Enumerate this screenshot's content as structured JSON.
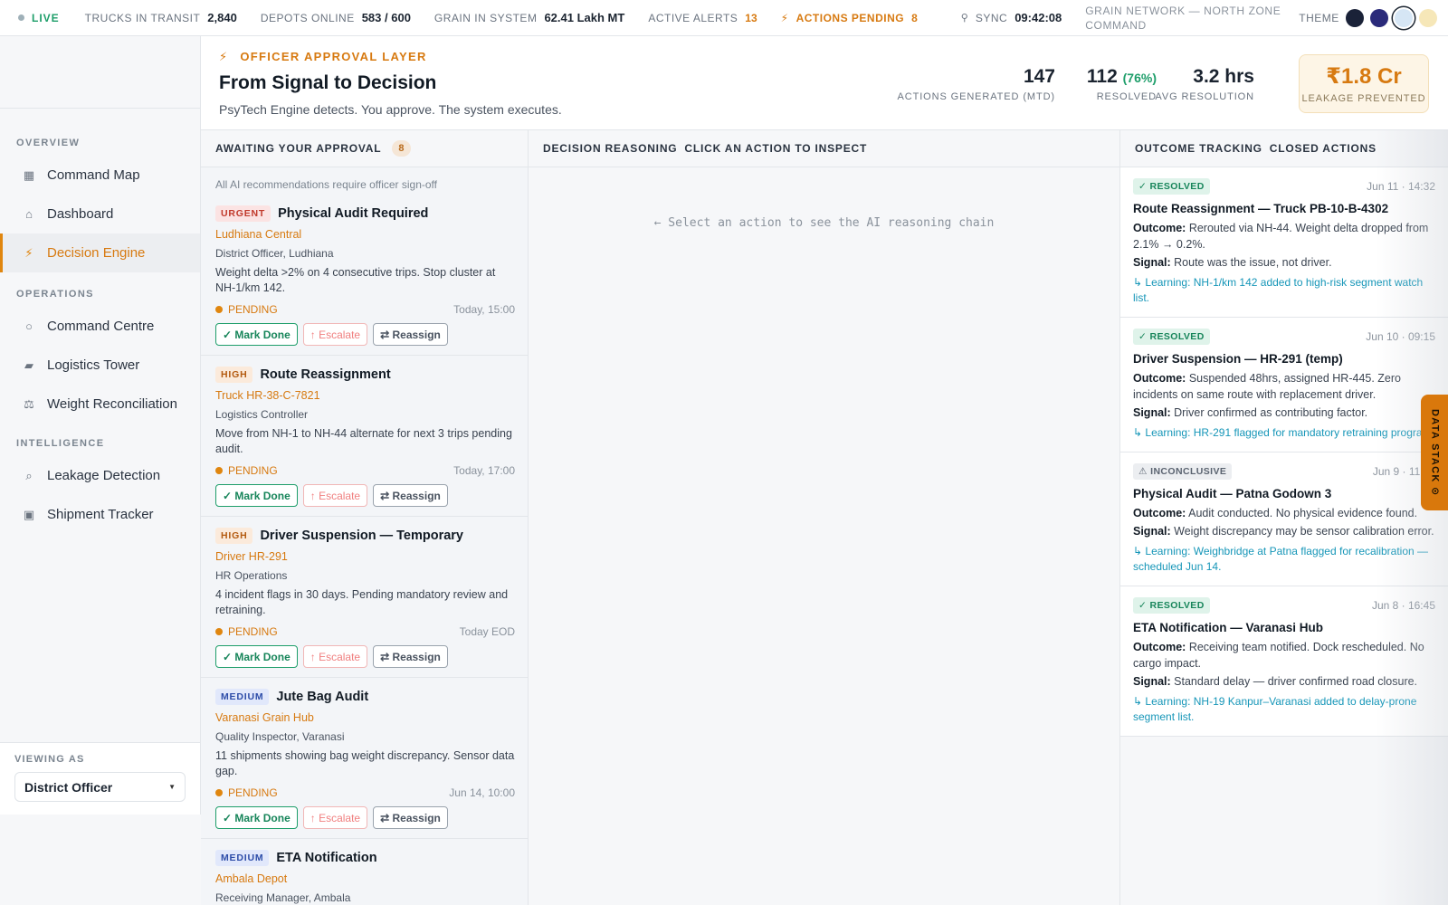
{
  "topbar": {
    "live": "LIVE",
    "trucks_label": "TRUCKS IN TRANSIT",
    "trucks_value": "2,840",
    "depots_label": "DEPOTS ONLINE",
    "depots_value": "583 / 600",
    "grain_label": "GRAIN IN SYSTEM",
    "grain_value": "62.41 Lakh MT",
    "alerts_label": "ACTIVE ALERTS",
    "alerts_value": "13",
    "actions_label": "ACTIONS PENDING",
    "actions_value": "8",
    "sync_label": "SYNC",
    "sync_value": "09:42:08",
    "network": "GRAIN NETWORK — NORTH ZONE COMMAND",
    "theme_label": "THEME",
    "theme_swatches": [
      "#1a2238",
      "#2a2a7a",
      "#d6e6f5",
      "#f6e7b8"
    ]
  },
  "sidebar": {
    "sections": [
      {
        "label": "OVERVIEW",
        "items": [
          {
            "label": "Command Map",
            "icon": "map-icon"
          },
          {
            "label": "Dashboard",
            "icon": "home-icon"
          },
          {
            "label": "Decision Engine",
            "icon": "bolt-icon",
            "active": true
          }
        ]
      },
      {
        "label": "OPERATIONS",
        "items": [
          {
            "label": "Command Centre",
            "icon": "circle-icon"
          },
          {
            "label": "Logistics Tower",
            "icon": "truck-icon"
          },
          {
            "label": "Weight Reconciliation",
            "icon": "scale-icon"
          }
        ]
      },
      {
        "label": "INTELLIGENCE",
        "items": [
          {
            "label": "Leakage Detection",
            "icon": "magnifier-icon"
          },
          {
            "label": "Shipment Tracker",
            "icon": "package-icon"
          }
        ]
      }
    ],
    "viewing_label": "VIEWING AS",
    "viewing_value": "District Officer"
  },
  "header": {
    "eyebrow": "OFFICER APPROVAL LAYER",
    "title": "From Signal to Decision",
    "subtitle": "PsyTech Engine detects. You approve. The system executes.",
    "stats": {
      "generated_value": "147",
      "generated_label": "ACTIONS GENERATED (MTD)",
      "resolved_value": "112",
      "resolved_pct": "(76%)",
      "resolved_label": "RESOLVED",
      "avg_value": "3.2 hrs",
      "avg_label": "AVG RESOLUTION",
      "leak_value": "₹1.8 Cr",
      "leak_label": "LEAKAGE PREVENTED"
    }
  },
  "approvals": {
    "title": "AWAITING YOUR APPROVAL",
    "count": "8",
    "note": "All AI recommendations require officer sign-off",
    "button_done": "✓ Mark Done",
    "button_escalate": "↑ Escalate",
    "button_reassign": "⇄ Reassign",
    "cards": [
      {
        "priority": "URGENT",
        "level": "urgent",
        "title": "Physical Audit Required",
        "target": "Ludhiana Central",
        "role": "District Officer, Ludhiana",
        "desc": "Weight delta >2% on 4 consecutive trips. Stop cluster at NH-1/km 142.",
        "status": "PENDING",
        "due": "Today, 15:00"
      },
      {
        "priority": "HIGH",
        "level": "high",
        "title": "Route Reassignment",
        "target": "Truck HR-38-C-7821",
        "role": "Logistics Controller",
        "desc": "Move from NH-1 to NH-44 alternate for next 3 trips pending audit.",
        "status": "PENDING",
        "due": "Today, 17:00"
      },
      {
        "priority": "HIGH",
        "level": "high",
        "title": "Driver Suspension — Temporary",
        "target": "Driver HR-291",
        "role": "HR Operations",
        "desc": "4 incident flags in 30 days. Pending mandatory review and retraining.",
        "status": "PENDING",
        "due": "Today EOD"
      },
      {
        "priority": "MEDIUM",
        "level": "medium",
        "title": "Jute Bag Audit",
        "target": "Varanasi Grain Hub",
        "role": "Quality Inspector, Varanasi",
        "desc": "11 shipments showing bag weight discrepancy. Sensor data gap.",
        "status": "PENDING",
        "due": "Jun 14, 10:00"
      },
      {
        "priority": "MEDIUM",
        "level": "medium",
        "title": "ETA Notification",
        "target": "Ambala Depot",
        "role": "Receiving Manager, Ambala",
        "desc": "",
        "status": "",
        "due": ""
      }
    ]
  },
  "reasoning": {
    "title": "DECISION REASONING",
    "hint": "CLICK AN ACTION TO INSPECT",
    "empty": "← Select an action to see the AI reasoning chain"
  },
  "outcomes": {
    "title": "OUTCOME TRACKING",
    "hint": "CLOSED ACTIONS",
    "outcome_label": "Outcome:",
    "signal_label": "Signal:",
    "cards": [
      {
        "badge": "✓ RESOLVED",
        "kind": "res",
        "date": "Jun 11 · 14:32",
        "title": "Route Reassignment — Truck PB-10-B-4302",
        "outcome": "Rerouted via NH-44. Weight delta dropped from 2.1% → 0.2%.",
        "signal": "Route was the issue, not driver.",
        "learning": "↳ Learning: NH-1/km 142 added to high-risk segment watch list."
      },
      {
        "badge": "✓ RESOLVED",
        "kind": "res",
        "date": "Jun 10 · 09:15",
        "title": "Driver Suspension — HR-291 (temp)",
        "outcome": "Suspended 48hrs, assigned HR-445. Zero incidents on same route with replacement driver.",
        "signal": "Driver confirmed as contributing factor.",
        "learning": "↳ Learning: HR-291 flagged for mandatory retraining program."
      },
      {
        "badge": "⚠ INCONCLUSIVE",
        "kind": "inc",
        "date": "Jun 9 · 11:20",
        "title": "Physical Audit — Patna Godown 3",
        "outcome": "Audit conducted. No physical evidence found.",
        "signal": "Weight discrepancy may be sensor calibration error.",
        "learning": "↳ Learning: Weighbridge at Patna flagged for recalibration — scheduled Jun 14."
      },
      {
        "badge": "✓ RESOLVED",
        "kind": "res",
        "date": "Jun 8 · 16:45",
        "title": "ETA Notification — Varanasi Hub",
        "outcome": "Receiving team notified. Dock rescheduled. No cargo impact.",
        "signal": "Standard delay — driver confirmed road closure.",
        "learning": "↳ Learning: NH-19 Kanpur–Varanasi added to delay-prone segment list."
      }
    ]
  },
  "data_stack": "DATA STACK ⊙"
}
